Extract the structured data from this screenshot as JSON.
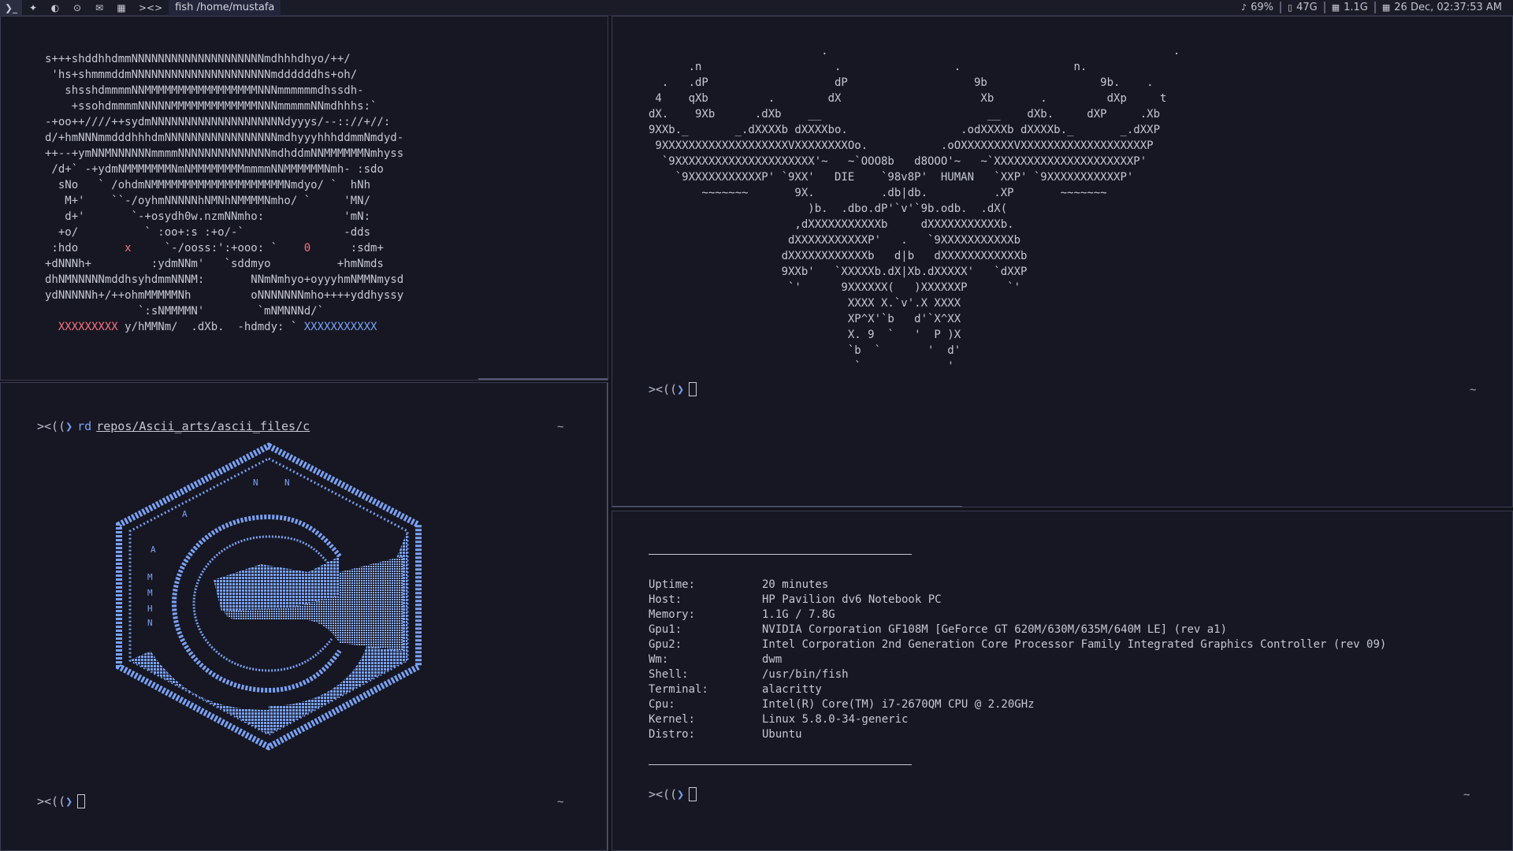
{
  "bar": {
    "workspaces": [
      "❯_",
      "✦",
      "◐",
      "⊙",
      "✉",
      "▦"
    ],
    "layout": "><>",
    "window_title": "fish /home/mustafa",
    "status": {
      "volume": "69%",
      "disk": "47G",
      "memory": "1.1G",
      "datetime": "26 Dec, 02:37:53 AM"
    }
  },
  "panes": {
    "top_left": {
      "art": [
        "s+++shddhhdmmNNNNNNNNNNNNNNNNNNNNmdhhhdhyo/++/",
        " 'hs+shmmmddmNNNNNNNNNNNNNNNNNNNNNmddddddhs+oh/",
        "   shsshdmmmmNNMMMMMMMMMMMMMMMMMNNNmmmmmmdhssdh-",
        "    +ssohdmmmmNNNNNMMMMMMMMMMMMMNNNmmmmmNNmdhhhs:`",
        "-+oo++////++sydmNNNNNNNNNNNNNNNNNNNNdyyys/--:://+//:",
        "d/+hmNNNmmdddhhhdmNNNNNNNNNNNNNNNNNmdhyyyhhhddmmNmdyd-",
        "++--+ymNNMNNNNNNmmmmNNNNNNNNNNNNNNmdhddmNNMMMMMMNmhyss",
        " /d+` -+ydmNMMMMMMMNmNMMMMMMMMmmmmNNMMMMMMNmh- :sdo",
        "  sNo   ` /ohdmNMMMMMMMMMMMMMMMMMMMMNmdyo/ `  hNh",
        "   M+'    ``-/oyhmNNNNNhNMNhNMMMMNmho/ `     'MN/",
        "   d+'       `-+osydh0w.nzmNNmho:            'mN:",
        "  +o/          ` :oo+:s :+o/-`               -dds",
        " :hdo       x     `-/ooss:':+ooo: `    0      :sdm+",
        "+dNNNh+         :ydmNNm'   `sddmyo          +hmNmds",
        "dhNMNNNNNmddhsyhdmmNNNM:       NNmNmhyo+oyyyhmNMMNmysd",
        "ydNNNNNh+/++ohmMMMMMNh         oNNNNNNNmho++++yddhyssy",
        "              `:sNMMMMN'        `mNMNNNd/`",
        "  XXXXXXXXX y/hMMNm/  .dXb.  -hdmdy: ` XXXXXXXXXXX"
      ]
    },
    "bottom_left": {
      "prompt_symbol": "><((",
      "prompt_arrow": "❯",
      "command": "rd",
      "path": "repos/Ascii_arts/ascii_files/c",
      "tilde": "~",
      "prompt2_symbol": "><((",
      "prompt2_arrow": "❯",
      "tilde2": "~"
    },
    "top_right": {
      "art": [
        "                          .                                                    .",
        "      .n                    .                 .                 n.",
        "  .   .dP                   dP                   9b                 9b.    .",
        " 4    qXb         .        dX                     Xb       .         dXp     t",
        "dX.    9Xb      .dXb    __                         __    dXb.     dXP     .Xb",
        "9XXb._       _.dXXXXb dXXXXbo.                 .odXXXXb dXXXXb._       _.dXXP",
        " 9XXXXXXXXXXXXXXXXXXXVXXXXXXXXOo.           .oOXXXXXXXXVXXXXXXXXXXXXXXXXXXXP",
        "  `9XXXXXXXXXXXXXXXXXXXXX'~   ~`OOO8b   d8OOO'~   ~`XXXXXXXXXXXXXXXXXXXXXP'",
        "    `9XXXXXXXXXXXP' `9XX'   DIE    `98v8P'  HUMAN   `XXP' `9XXXXXXXXXXXP'",
        "        ~~~~~~~       9X.          .db|db.          .XP       ~~~~~~~",
        "                        )b.  .dbo.dP'`v'`9b.odb.  .dX(",
        "                      ,dXXXXXXXXXXXb     dXXXXXXXXXXXb.",
        "                     dXXXXXXXXXXXP'   .   `9XXXXXXXXXXXb",
        "                    dXXXXXXXXXXXXb   d|b   dXXXXXXXXXXXXb",
        "                    9XXb'   `XXXXXb.dX|Xb.dXXXXX'   `dXXP",
        "                     `'      9XXXXXX(   )XXXXXXP      `'",
        "                              XXXX X.`v'.X XXXX",
        "                              XP^X'`b   d'`X^XX",
        "                              X. 9  `   '  P )X",
        "                              `b  `       '  d'",
        "                               `             '"
      ],
      "prompt_symbol": "><((",
      "prompt_arrow": "❯",
      "tilde": "~"
    },
    "bottom_right": {
      "info": [
        {
          "key": "Uptime:",
          "value": "20 minutes"
        },
        {
          "key": "Host:",
          "value": "HP Pavilion dv6 Notebook PC"
        },
        {
          "key": "Memory:",
          "value": "1.1G / 7.8G"
        },
        {
          "key": "Gpu1:",
          "value": "NVIDIA Corporation GF108M [GeForce GT 620M/630M/635M/640M LE] (rev a1)"
        },
        {
          "key": "Gpu2:",
          "value": "Intel Corporation 2nd Generation Core Processor Family Integrated Graphics Controller (rev 09)"
        },
        {
          "key": "Wm:",
          "value": "dwm"
        },
        {
          "key": "Shell:",
          "value": "/usr/bin/fish"
        },
        {
          "key": "Terminal:",
          "value": "alacritty"
        },
        {
          "key": "Cpu:",
          "value": "Intel(R) Core(TM) i7-2670QM CPU @ 2.20GHz"
        },
        {
          "key": "Kernel:",
          "value": "Linux 5.8.0-34-generic"
        },
        {
          "key": "Distro:",
          "value": "Ubuntu"
        }
      ],
      "prompt_symbol": "><((",
      "prompt_arrow": "❯",
      "tilde": "~"
    }
  }
}
